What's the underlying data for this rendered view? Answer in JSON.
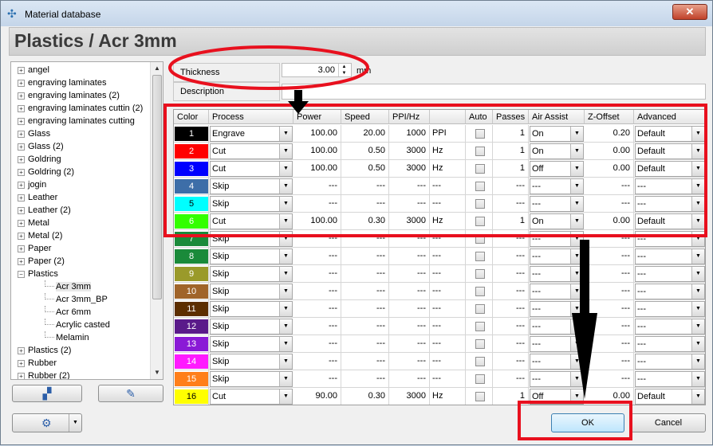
{
  "window": {
    "title": "Material database",
    "close_glyph": "✕"
  },
  "header": {
    "title": "Plastics / Acr 3mm"
  },
  "tree": {
    "items": [
      {
        "label": "angel",
        "expander": "+",
        "child": false,
        "selected": false
      },
      {
        "label": "engraving laminates",
        "expander": "+",
        "child": false,
        "selected": false
      },
      {
        "label": "engraving laminates (2)",
        "expander": "+",
        "child": false,
        "selected": false
      },
      {
        "label": "engraving laminates cuttin (2)",
        "expander": "+",
        "child": false,
        "selected": false
      },
      {
        "label": "engraving laminates cutting",
        "expander": "+",
        "child": false,
        "selected": false
      },
      {
        "label": "Glass",
        "expander": "+",
        "child": false,
        "selected": false
      },
      {
        "label": "Glass (2)",
        "expander": "+",
        "child": false,
        "selected": false
      },
      {
        "label": "Goldring",
        "expander": "+",
        "child": false,
        "selected": false
      },
      {
        "label": "Goldring (2)",
        "expander": "+",
        "child": false,
        "selected": false
      },
      {
        "label": "jogin",
        "expander": "+",
        "child": false,
        "selected": false
      },
      {
        "label": "Leather",
        "expander": "+",
        "child": false,
        "selected": false
      },
      {
        "label": "Leather (2)",
        "expander": "+",
        "child": false,
        "selected": false
      },
      {
        "label": "Metal",
        "expander": "+",
        "child": false,
        "selected": false
      },
      {
        "label": "Metal (2)",
        "expander": "+",
        "child": false,
        "selected": false
      },
      {
        "label": "Paper",
        "expander": "+",
        "child": false,
        "selected": false
      },
      {
        "label": "Paper (2)",
        "expander": "+",
        "child": false,
        "selected": false
      },
      {
        "label": "Plastics",
        "expander": "−",
        "child": false,
        "selected": false
      },
      {
        "label": "Acr 3mm",
        "expander": "",
        "child": true,
        "selected": true
      },
      {
        "label": "Acr 3mm_BP",
        "expander": "",
        "child": true,
        "selected": false
      },
      {
        "label": "Acr 6mm",
        "expander": "",
        "child": true,
        "selected": false
      },
      {
        "label": "Acrylic casted",
        "expander": "",
        "child": true,
        "selected": false
      },
      {
        "label": "Melamin",
        "expander": "",
        "child": true,
        "selected": false
      },
      {
        "label": "Plastics (2)",
        "expander": "+",
        "child": false,
        "selected": false
      },
      {
        "label": "Rubber",
        "expander": "+",
        "child": false,
        "selected": false
      },
      {
        "label": "Rubber (2)",
        "expander": "+",
        "child": false,
        "selected": false
      }
    ]
  },
  "form": {
    "thickness_label": "Thickness",
    "thickness_value": "3.00",
    "thickness_unit": "mm",
    "description_label": "Description",
    "description_value": ""
  },
  "grid": {
    "headers": [
      "Color",
      "Process",
      "Power",
      "Speed",
      "PPI/Hz",
      "",
      "Auto",
      "Passes",
      "Air Assist",
      "Z-Offset",
      "Advanced"
    ],
    "rows": [
      {
        "num": "1",
        "color": "#000000",
        "text_color": "#ffffff",
        "process": "Engrave",
        "power": "100.00",
        "speed": "20.00",
        "ppi": "1000",
        "unit": "PPI",
        "passes": "1",
        "air": "On",
        "z": "0.20",
        "adv": "Default"
      },
      {
        "num": "2",
        "color": "#ff0000",
        "text_color": "#ffffff",
        "process": "Cut",
        "power": "100.00",
        "speed": "0.50",
        "ppi": "3000",
        "unit": "Hz",
        "passes": "1",
        "air": "On",
        "z": "0.00",
        "adv": "Default"
      },
      {
        "num": "3",
        "color": "#0000ff",
        "text_color": "#ffffff",
        "process": "Cut",
        "power": "100.00",
        "speed": "0.50",
        "ppi": "3000",
        "unit": "Hz",
        "passes": "1",
        "air": "Off",
        "z": "0.00",
        "adv": "Default"
      },
      {
        "num": "4",
        "color": "#3d6ea8",
        "text_color": "#ffffff",
        "process": "Skip",
        "power": "---",
        "speed": "---",
        "ppi": "---",
        "unit": "---",
        "passes": "---",
        "air": "---",
        "z": "---",
        "adv": "---"
      },
      {
        "num": "5",
        "color": "#00ffff",
        "text_color": "#000000",
        "process": "Skip",
        "power": "---",
        "speed": "---",
        "ppi": "---",
        "unit": "---",
        "passes": "---",
        "air": "---",
        "z": "---",
        "adv": "---"
      },
      {
        "num": "6",
        "color": "#33ff00",
        "text_color": "#ffffff",
        "process": "Cut",
        "power": "100.00",
        "speed": "0.30",
        "ppi": "3000",
        "unit": "Hz",
        "passes": "1",
        "air": "On",
        "z": "0.00",
        "adv": "Default"
      },
      {
        "num": "7",
        "color": "#1a8a3a",
        "text_color": "#ffffff",
        "process": "Skip",
        "power": "---",
        "speed": "---",
        "ppi": "---",
        "unit": "---",
        "passes": "---",
        "air": "---",
        "z": "---",
        "adv": "---"
      },
      {
        "num": "8",
        "color": "#1a8a3a",
        "text_color": "#ffffff",
        "process": "Skip",
        "power": "---",
        "speed": "---",
        "ppi": "---",
        "unit": "---",
        "passes": "---",
        "air": "---",
        "z": "---",
        "adv": "---"
      },
      {
        "num": "9",
        "color": "#9a9a2a",
        "text_color": "#ffffff",
        "process": "Skip",
        "power": "---",
        "speed": "---",
        "ppi": "---",
        "unit": "---",
        "passes": "---",
        "air": "---",
        "z": "---",
        "adv": "---"
      },
      {
        "num": "10",
        "color": "#a0642a",
        "text_color": "#ffffff",
        "process": "Skip",
        "power": "---",
        "speed": "---",
        "ppi": "---",
        "unit": "---",
        "passes": "---",
        "air": "---",
        "z": "---",
        "adv": "---"
      },
      {
        "num": "11",
        "color": "#5c2e00",
        "text_color": "#ffffff",
        "process": "Skip",
        "power": "---",
        "speed": "---",
        "ppi": "---",
        "unit": "---",
        "passes": "---",
        "air": "---",
        "z": "---",
        "adv": "---"
      },
      {
        "num": "12",
        "color": "#5a1a8a",
        "text_color": "#ffffff",
        "process": "Skip",
        "power": "---",
        "speed": "---",
        "ppi": "---",
        "unit": "---",
        "passes": "---",
        "air": "---",
        "z": "---",
        "adv": "---"
      },
      {
        "num": "13",
        "color": "#8a1ad6",
        "text_color": "#ffffff",
        "process": "Skip",
        "power": "---",
        "speed": "---",
        "ppi": "---",
        "unit": "---",
        "passes": "---",
        "air": "---",
        "z": "---",
        "adv": "---"
      },
      {
        "num": "14",
        "color": "#ff1aff",
        "text_color": "#ffffff",
        "process": "Skip",
        "power": "---",
        "speed": "---",
        "ppi": "---",
        "unit": "---",
        "passes": "---",
        "air": "---",
        "z": "---",
        "adv": "---"
      },
      {
        "num": "15",
        "color": "#ff7f1a",
        "text_color": "#ffffff",
        "process": "Skip",
        "power": "---",
        "speed": "---",
        "ppi": "---",
        "unit": "---",
        "passes": "---",
        "air": "---",
        "z": "---",
        "adv": "---"
      },
      {
        "num": "16",
        "color": "#ffff00",
        "text_color": "#000000",
        "process": "Cut",
        "power": "90.00",
        "speed": "0.30",
        "ppi": "3000",
        "unit": "Hz",
        "passes": "1",
        "air": "Off",
        "z": "0.00",
        "adv": "Default"
      }
    ]
  },
  "buttons": {
    "ok": "OK",
    "cancel": "Cancel"
  },
  "colors": {
    "annotation_red": "#e8101e",
    "accent_blue": "#2b5ea8"
  },
  "icons": {
    "add_material": "add-material-icon",
    "add_group": "add-group-icon",
    "settings": "gear-icon"
  }
}
